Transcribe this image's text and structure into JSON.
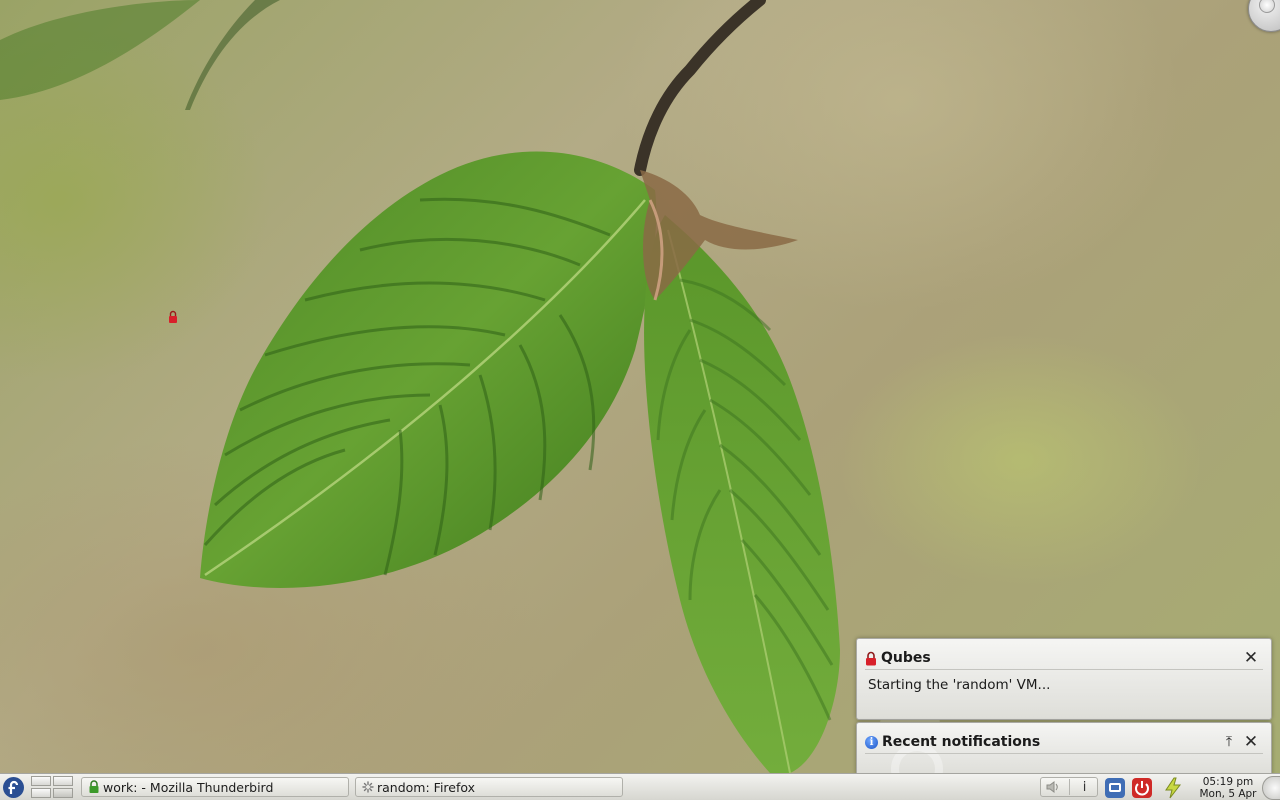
{
  "notifications": {
    "qubes": {
      "title": "Qubes",
      "body": "Starting the 'random' VM..."
    },
    "recent": {
      "title": "Recent notifications"
    }
  },
  "taskbar": {
    "tasks": [
      {
        "label": "work: - Mozilla Thunderbird",
        "icon": "green-lock-icon"
      },
      {
        "label": "random: Firefox",
        "icon": "loading-spinner-icon"
      }
    ],
    "clock": {
      "time": "05:19 pm",
      "date": "Mon, 5 Apr"
    }
  },
  "colors": {
    "panel": "#e4e4df",
    "qubes_red": "#d8202a",
    "work_green": "#3c9a2a",
    "info_blue": "#2a63d6"
  }
}
